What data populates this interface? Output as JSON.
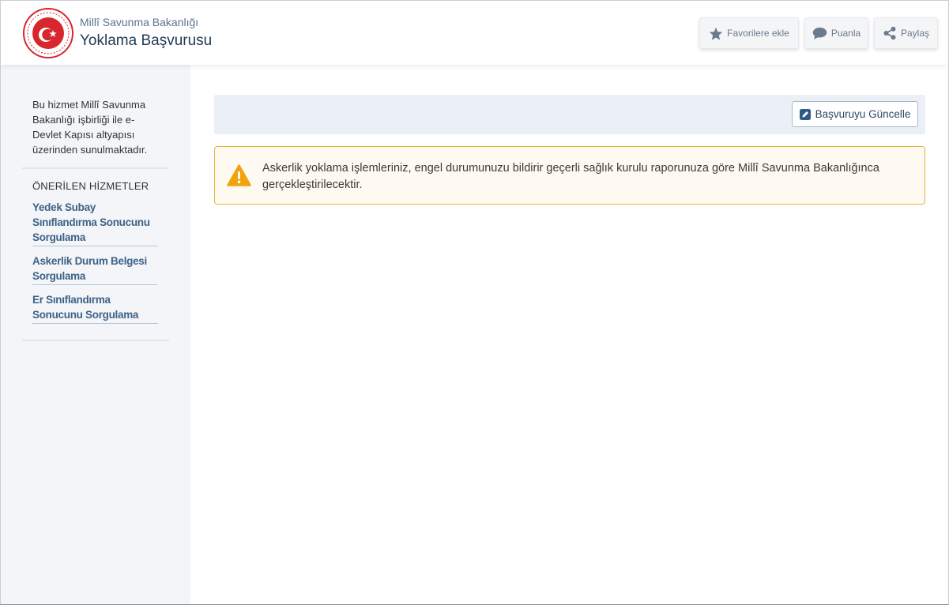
{
  "header": {
    "org_name": "Millî Savunma Bakanlığı",
    "service_title": "Yoklama Başvurusu",
    "buttons": {
      "favorites": "Favorilere ekle",
      "rate": "Puanla",
      "share": "Paylaş"
    }
  },
  "sidebar": {
    "info": "Bu hizmet Millî Savunma Bakanlığı işbirliği ile e-Devlet Kapısı altyapısı üzerinden sunulmaktadır.",
    "recommended_title": "ÖNERİLEN HİZMETLER",
    "recommended": [
      {
        "label": "Yedek Subay Sınıflandırma Sonucunu Sorgulama"
      },
      {
        "label": "Askerlik Durum Belgesi Sorgulama"
      },
      {
        "label": "Er Sınıflandırma Sonucunu Sorgulama"
      }
    ]
  },
  "main": {
    "update_button": "Başvuruyu Güncelle",
    "alert_text": "Askerlik yoklama işlemleriniz, engel durumunuzu bildirir geçerli sağlık kurulu raporunuza göre Millî Savunma Bakanlığınca gerçekleştirilecektir."
  },
  "colors": {
    "link": "#3e6288",
    "alert_border": "#e8b53a",
    "alert_icon": "#f2a20c",
    "logo_red": "#d8262e"
  },
  "icons": {
    "logo": "msb-emblem-icon",
    "favorites": "star-icon",
    "rate": "comment-icon",
    "share": "share-icon",
    "update": "edit-icon",
    "alert": "warning-icon"
  }
}
